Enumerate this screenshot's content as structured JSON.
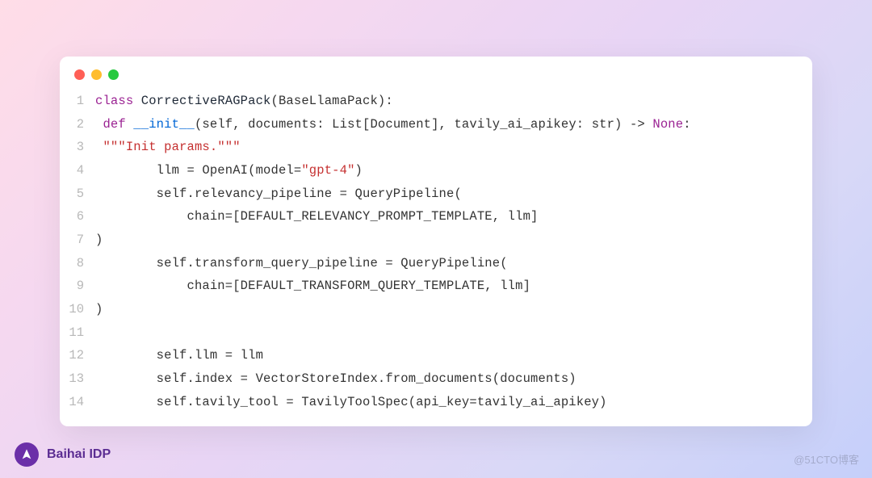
{
  "brand": "Baihai IDP",
  "watermark": "@51CTO博客",
  "colors": {
    "red_dot": "#ff5f56",
    "yellow_dot": "#ffbd2e",
    "green_dot": "#27c93f",
    "keyword": "#9b2393",
    "string": "#c53030",
    "function": "#0066d6"
  },
  "lines": [
    {
      "n": "1",
      "indent": "",
      "tokens": [
        {
          "t": "class ",
          "c": "kw"
        },
        {
          "t": "CorrectiveRAGPack",
          "c": "cls"
        },
        {
          "t": "(BaseLlamaPack):",
          "c": "punc"
        }
      ]
    },
    {
      "n": "2",
      "indent": " ",
      "tokens": [
        {
          "t": "def ",
          "c": "kw"
        },
        {
          "t": "__init__",
          "c": "fn"
        },
        {
          "t": "(self, documents: List[Document], tavily_ai_apikey: str) -> ",
          "c": "param"
        },
        {
          "t": "None",
          "c": "kw"
        },
        {
          "t": ":",
          "c": "punc"
        }
      ]
    },
    {
      "n": "3",
      "indent": " ",
      "tokens": [
        {
          "t": "\"\"\"Init params.\"\"\"",
          "c": "doc"
        }
      ]
    },
    {
      "n": "4",
      "indent": "        ",
      "tokens": [
        {
          "t": "llm = OpenAI(model=",
          "c": "punc"
        },
        {
          "t": "\"gpt-4\"",
          "c": "str"
        },
        {
          "t": ")",
          "c": "punc"
        }
      ]
    },
    {
      "n": "5",
      "indent": "        ",
      "tokens": [
        {
          "t": "self.relevancy_pipeline = QueryPipeline(",
          "c": "punc"
        }
      ]
    },
    {
      "n": "6",
      "indent": "            ",
      "tokens": [
        {
          "t": "chain=[DEFAULT_RELEVANCY_PROMPT_TEMPLATE, llm]",
          "c": "punc"
        }
      ]
    },
    {
      "n": "7",
      "indent": "",
      "tokens": [
        {
          "t": ")",
          "c": "punc"
        }
      ]
    },
    {
      "n": "8",
      "indent": "        ",
      "tokens": [
        {
          "t": "self.transform_query_pipeline = QueryPipeline(",
          "c": "punc"
        }
      ]
    },
    {
      "n": "9",
      "indent": "            ",
      "tokens": [
        {
          "t": "chain=[DEFAULT_TRANSFORM_QUERY_TEMPLATE, llm]",
          "c": "punc"
        }
      ]
    },
    {
      "n": "10",
      "indent": "",
      "tokens": [
        {
          "t": ")",
          "c": "punc"
        }
      ]
    },
    {
      "n": "11",
      "indent": "",
      "tokens": []
    },
    {
      "n": "12",
      "indent": "        ",
      "tokens": [
        {
          "t": "self.llm = llm",
          "c": "punc"
        }
      ]
    },
    {
      "n": "13",
      "indent": "        ",
      "tokens": [
        {
          "t": "self.index = VectorStoreIndex.from_documents(documents)",
          "c": "punc"
        }
      ]
    },
    {
      "n": "14",
      "indent": "        ",
      "tokens": [
        {
          "t": "self.tavily_tool = TavilyToolSpec(api_key=tavily_ai_apikey)",
          "c": "punc"
        }
      ]
    }
  ]
}
